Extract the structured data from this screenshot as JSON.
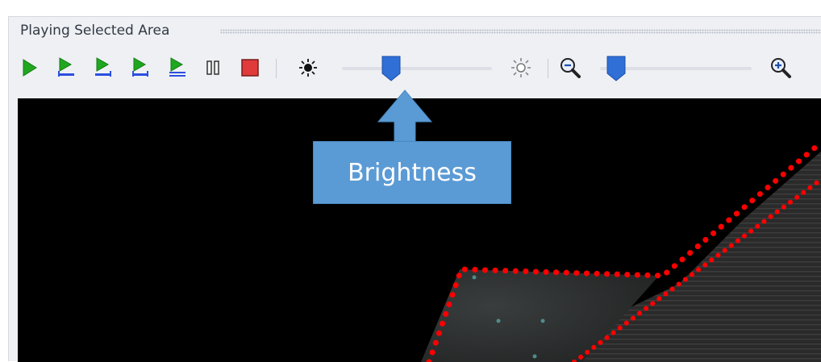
{
  "panel": {
    "title": "Playing Selected Area"
  },
  "toolbar": {
    "buttons": [
      {
        "name": "play-icon"
      },
      {
        "name": "play-selection-icon"
      },
      {
        "name": "play-to-end-icon"
      },
      {
        "name": "play-selection-loop-icon"
      },
      {
        "name": "play-loop-icon"
      },
      {
        "name": "pause-icon"
      },
      {
        "name": "stop-icon"
      }
    ],
    "brightness_low_icon": "sun-small-icon",
    "brightness_high_icon": "sun-outline-icon",
    "zoom_out_icon": "zoom-out-icon",
    "zoom_in_icon": "zoom-in-icon",
    "brightness_level": 0.3,
    "zoom_level": 0.05
  },
  "callout": {
    "label": "Brightness",
    "color": "#5b9bd5"
  },
  "colors": {
    "play_green": "#1fa81f",
    "stop_red": "#e03a3a",
    "slider_blue": "#2f6fd6",
    "selection_outline": "#ff0000",
    "video_background": "#000000"
  }
}
